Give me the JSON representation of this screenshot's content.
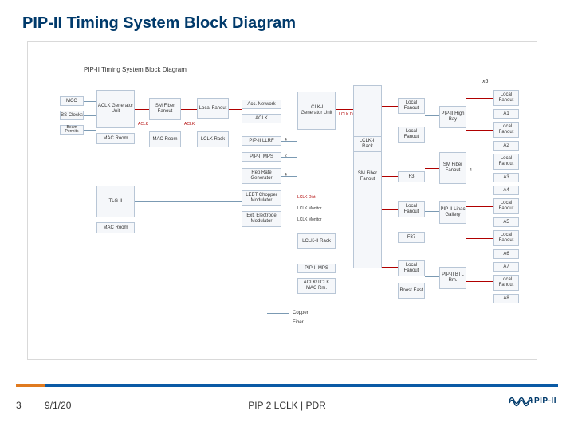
{
  "header": {
    "title": "PIP-II Timing System Block Diagram"
  },
  "diagram": {
    "subtitle": "PIP-II Timing System Block Diagram",
    "boxes": {
      "aclk_gen": "ACLK\nGenerator\nUnit",
      "sm_fiber_fanout": "SM Fiber\nFanout",
      "local_fanout_1": "Local\nFanout",
      "lclk_gen": "LCLK-II\nGenerator\nUnit",
      "sm_fiber_fanout2": "SM Fiber\nFanout",
      "tlg": "TLG-II",
      "mco": "MCO",
      "bs_clocks": "BS Clocks",
      "beam_permits": "Beam Permits",
      "mac_room": "MAC Room",
      "mac_room2": "MAC Room",
      "mac_room3": "MAC\nRoom",
      "aclk": "ACLK",
      "aclk2": "ACLK",
      "lclk_rack": "LCLK\nRack",
      "acc_network": "Acc. Network",
      "pip2_llrf": "PIP-II LLRF",
      "pip2_mps": "PIP-II MPS",
      "rep_rate": "Rep Rate\nGenerator",
      "lebt_chopper": "LEBT Chopper\nModulator",
      "ext_electrode": "Ext. Electrode\nModulator",
      "lclk_rack2": "LCLK-II\nRack",
      "pip2_mps_bottom": "PIP-II MPS",
      "aclk_tclk_mac": "ACLK/TCLK\nMAC Rm.",
      "lclk_dist": "LCLK Dist",
      "lclk_rack3": "LCLK-II\nRack",
      "f3": "F3",
      "f37": "F37",
      "boost_east": "Boost\nEast",
      "highbay": "PIP-II\nHigh\nBay",
      "linac_gallery": "PIP-II\nLinac\nGallery",
      "btl_rm": "PIP-II\nBTL\nRm.",
      "sm_fiber_fanout3": "SM Fiber\nFanout",
      "local_fanout": "Local\nFanout",
      "a1": "A1",
      "a2": "A2",
      "a3": "A3",
      "a4": "A4",
      "a5": "A5",
      "a6": "A6",
      "a7": "A7",
      "a8": "A8"
    },
    "labels": {
      "num4a": "4",
      "num2": "2",
      "num4b": "4",
      "num4c": "4",
      "x6": "x6",
      "lclk_dist_lbl": "LCLK Dist",
      "lclk_monitor": "LCLK Monitor",
      "lclk_monitor2": "LCLK Monitor",
      "legend_copper": "Copper",
      "legend_fiber": "Fiber"
    }
  },
  "footer": {
    "slide_num": "3",
    "date": "9/1/20",
    "center": "PIP 2 LCLK | PDR",
    "logo_text": "PIP-II"
  }
}
